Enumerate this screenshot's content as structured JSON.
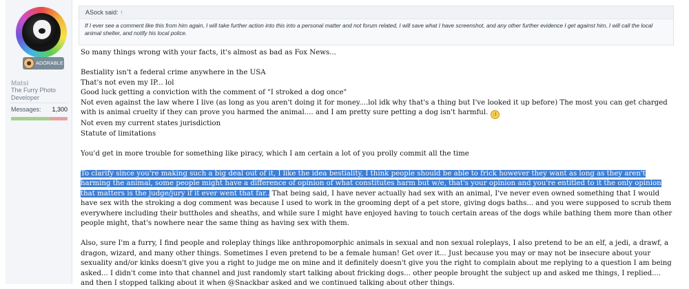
{
  "user": {
    "username": "Matsi",
    "title": "The Furry Photo Developer",
    "badge_text": "ADORABLE",
    "stats": {
      "messages_label": "Messages:",
      "messages_value": "1,300"
    },
    "rating_fraction": 0.7
  },
  "quote": {
    "author_line": "ASock said:",
    "arrow": "↑",
    "text": "If I ever see a comment like this from him again, I will take further action into this into a personal matter and not forum related, I will save what I have screenshot, and any other further evidence I get against him, I will call the local animal shelter, and notify his local police."
  },
  "message": {
    "p1": "So many things wrong with your facts, it's almost as bad as Fox News...",
    "l1": "Bestiality isn't a federal crime anywhere in the USA",
    "l2": "That's not even my IP... lol",
    "l3": "Good luck getting a conviction with the comment of \"I stroked a dog once\"",
    "l4": "Not even against the law where I live (as long as you aren't doing it for money....lol idk why that's a thing but I've looked it up before) The most you can get charged with is animal cruelty if they can prove you harmed the animal.... and I am pretty sure petting a dog isn't harmful.",
    "l5": "Not even my current states jurisdiction",
    "l6": "Statute of limitations",
    "p3": "You'd get in more trouble for something like piracy, which I am certain a lot of you prolly commit all the time",
    "p4_highlight": "To clarify since you're making such a big deal out of it, I like the idea bestiality, I think people should be able to frick however they want as long as they aren't harming the animal, some people might have a difference of opinion of what constitutes harm but w/e, that's your opinion and you're entitled to it the only opinion that matters is the judge/jury if it ever went that far..",
    "p4_rest": " That being said, I have never actually had sex with an animal, I've never even owned something that I would have sex with the stroking a dog comment was because I used to work in the grooming dept of a pet store, giving dogs baths... and you were supposed to scrub them everywhere including their buttholes and sheaths, and while sure I might have enjoyed having to touch certain areas of the dogs while bathing them more than other people might, that's nowhere near the same thing as having sex with them.",
    "p5": "Also, sure I'm a furry, I find people and roleplay things like anthropomorphic animals in sexual and non sexual roleplays, I also pretend to be an elf, a jedi, a drawf, a dragon, wizard, and many other things. Sometimes I even pretend to be a female human! Get over it... Just because you may or may not be insecure about your sexuality and/or kinks doesn't give you a right to judge me on mine and it definitely doesn't give you the right to complain about me replying to a question I am being asked... I didn't come into that channel and just randomly start talking about fricking dogs... other people brought the subject up and asked me things, I replied.... and then I stopped talking about it when @Snackbar asked and we continued talking about other things."
  },
  "icons": {
    "emoji": "smile-emoji-icon",
    "badge": "dog-face-icon"
  },
  "colors": {
    "highlight": "#3f7fd5",
    "sidebar_bg": "#f3f5f8"
  }
}
